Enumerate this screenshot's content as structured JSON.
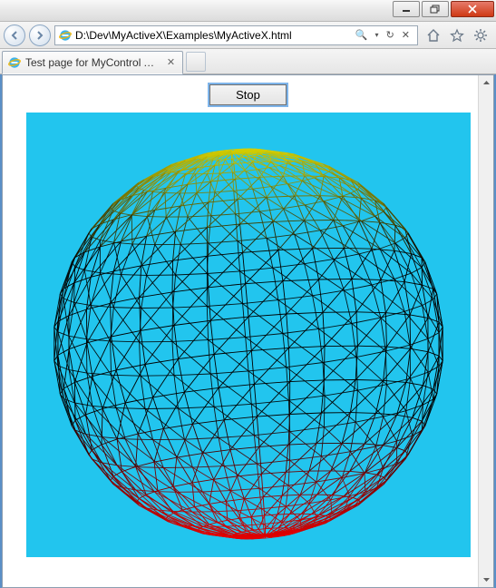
{
  "window": {
    "min_tip": "Minimize",
    "max_tip": "Restore",
    "close_tip": "Close"
  },
  "address": {
    "url": "D:\\Dev\\MyActiveX\\Examples\\MyActiveX.html",
    "search_glyph": "🔍",
    "refresh_glyph": "↻",
    "stop_glyph": "✕"
  },
  "toolbar": {
    "home_tip": "Home",
    "fav_tip": "Favorites",
    "tools_tip": "Tools"
  },
  "tabs": [
    {
      "title": "Test page for MyControl Ac..."
    }
  ],
  "page": {
    "stop_label": "Stop"
  },
  "colors": {
    "canvas_bg": "#22c5ee",
    "wire_top": "#d6d000",
    "wire_mid": "#000000",
    "wire_bot": "#e60000"
  }
}
